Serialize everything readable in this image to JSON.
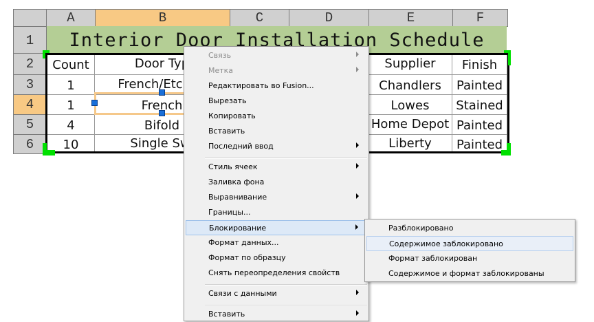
{
  "columns": [
    "A",
    "B",
    "C",
    "D",
    "E",
    "F"
  ],
  "rows": [
    "1",
    "2",
    "3",
    "4",
    "5",
    "6"
  ],
  "title": "Interior Door Installation Schedule",
  "header_row": [
    "Count",
    "Door Typ",
    "",
    "",
    "Supplier",
    "Finish"
  ],
  "data_rows": [
    [
      "1",
      "French/Etched",
      "Chandlers",
      "Painted"
    ],
    [
      "1",
      "French",
      "Lowes",
      "Stained"
    ],
    [
      "4",
      "Bifold",
      "Home Depot",
      "Painted"
    ],
    [
      "10",
      "Single Swi",
      "Liberty",
      "Painted"
    ]
  ],
  "context_menu": {
    "items": [
      {
        "label": "Связь",
        "submenu": true,
        "disabled": true
      },
      {
        "label": "Метка",
        "submenu": true,
        "disabled": true
      },
      {
        "label": "Редактировать во Fusion...",
        "submenu": false
      },
      {
        "label": "Вырезать",
        "submenu": false
      },
      {
        "label": "Копировать",
        "submenu": false
      },
      {
        "label": "Вставить",
        "submenu": false
      },
      {
        "label": "Последний ввод",
        "submenu": true
      },
      {
        "label": "Стиль ячеек",
        "submenu": true
      },
      {
        "label": "Заливка фона",
        "submenu": false
      },
      {
        "label": "Выравнивание",
        "submenu": true
      },
      {
        "label": "Границы...",
        "submenu": false
      },
      {
        "label": "Блокирование",
        "submenu": true,
        "highlighted": true
      },
      {
        "label": "Формат данных...",
        "submenu": false
      },
      {
        "label": "Формат по образцу",
        "submenu": false
      },
      {
        "label": "Снять переопределения свойств",
        "submenu": false
      },
      {
        "label": "Связи с данными",
        "submenu": true
      },
      {
        "label": "Вставить",
        "submenu": true
      }
    ]
  },
  "locking_submenu": {
    "items": [
      {
        "label": "Разблокировано"
      },
      {
        "label": "Содержимое заблокировано",
        "highlighted": true
      },
      {
        "label": "Формат заблокирован"
      },
      {
        "label": "Содержимое и формат заблокированы"
      }
    ]
  },
  "colors": {
    "title_fill": "#b4ce95",
    "selected_header": "#f8c984",
    "grip": "#00e000",
    "menu_bg": "#f0f0f0",
    "menu_highlight": "#dde9f7"
  }
}
